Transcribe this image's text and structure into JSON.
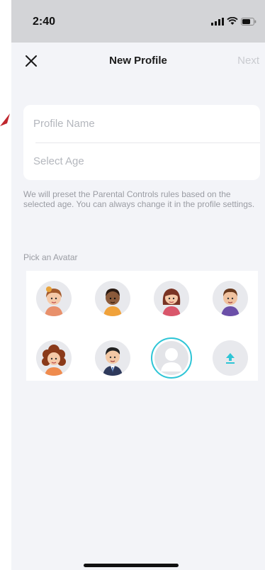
{
  "status_bar": {
    "time": "2:40"
  },
  "nav": {
    "title": "New Profile",
    "next_label": "Next"
  },
  "form": {
    "name_placeholder": "Profile Name",
    "age_placeholder": "Select Age"
  },
  "helper_text": "We will preset the Parental Controls rules based on the selected age. You can always change it in the profile settings.",
  "avatar_section": {
    "label": "Pick an Avatar",
    "avatars": [
      {
        "icon": "girl-blonde-bun-avatar-icon"
      },
      {
        "icon": "boy-dark-skin-avatar-icon"
      },
      {
        "icon": "girl-brown-hair-avatar-icon"
      },
      {
        "icon": "boy-purple-shirt-avatar-icon"
      },
      {
        "icon": "girl-curly-hair-avatar-icon"
      },
      {
        "icon": "man-suit-avatar-icon"
      },
      {
        "icon": "default-silhouette-avatar-icon",
        "selected": true
      },
      {
        "icon": "upload-icon"
      }
    ]
  },
  "colors": {
    "accent": "#2ec5d6",
    "sheet_bg": "#f3f4f8",
    "status_bar_bg": "#d3d4d7",
    "next_disabled": "#c9cbd0"
  }
}
